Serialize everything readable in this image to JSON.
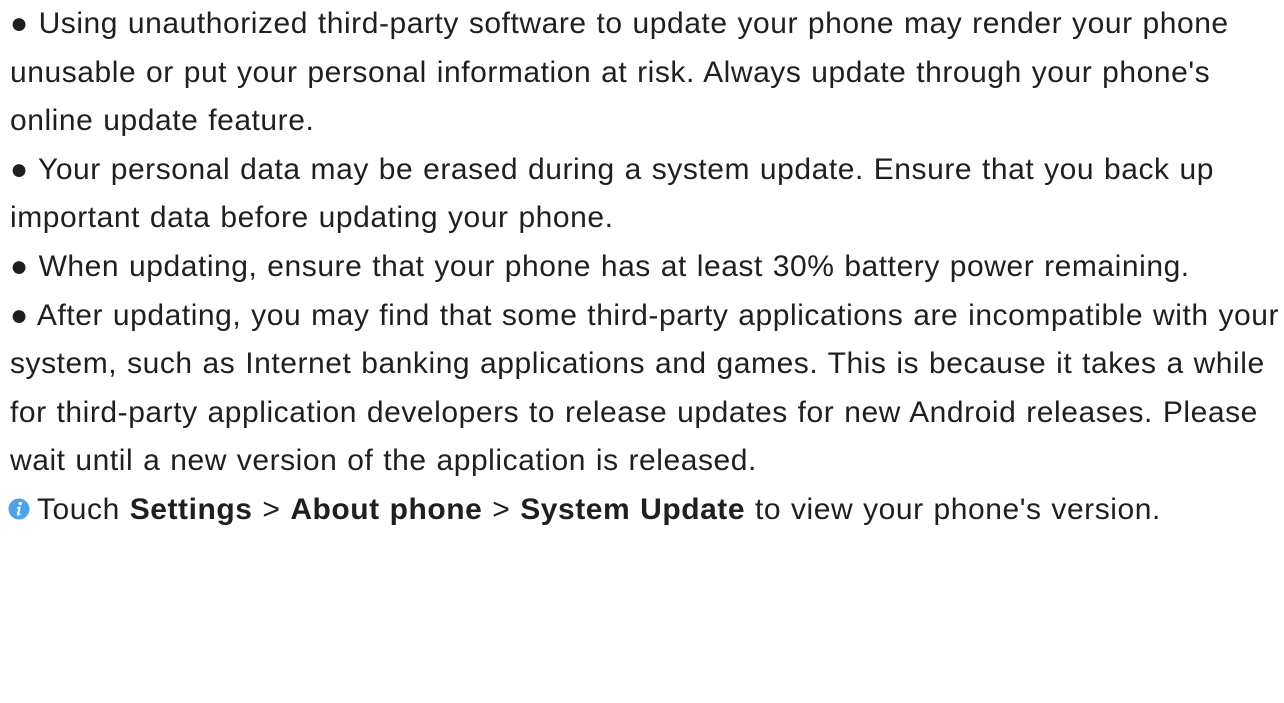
{
  "bullet_symbol": "●",
  "bullets": [
    {
      "text": "Using unauthorized third-party software to update your phone may render your phone unusable or put your personal information at risk. Always update through your phone's online update feature."
    },
    {
      "text": "Your personal data may be erased during a system update. Ensure that you back up important data before updating your phone."
    },
    {
      "text": "When updating, ensure that your phone has at least 30% battery power remaining."
    },
    {
      "text": "After updating, you may find that some third-party applications are incompatible with your system, such as Internet banking applications and games. This is because it takes a while for third-party application developers to release updates for new Android releases. Please wait until a new version of the application is released."
    }
  ],
  "tip": {
    "icon": "info-icon",
    "icon_color": "#4da3ea",
    "prefix": "Touch",
    "path": [
      "Settings",
      "About phone",
      "System Update"
    ],
    "separator": ">",
    "suffix": "to view your phone's version."
  }
}
